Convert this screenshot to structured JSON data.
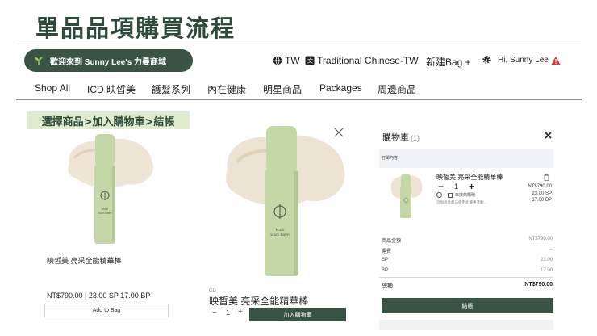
{
  "page": {
    "title": "單品品項購買流程"
  },
  "header": {
    "welcome_text": "歡迎來到 Sunny Lee's  力曼商城",
    "region": "TW",
    "language": "Traditional Chinese-TW",
    "new_bag": "新建Bag +",
    "greeting": "Hi, Sunny Lee"
  },
  "nav": {
    "items": [
      "Shop All",
      "ICD 映皙美",
      "護髮系列",
      "內在健康",
      "明星商品",
      "Packages",
      "周邊商品"
    ]
  },
  "steps": {
    "label": "選擇商品>加入購物車>結帳"
  },
  "product_card": {
    "name": "映皙美 亮采全能精華棒",
    "price": "NT$790.00 | 23.00 SP 17.00 BP",
    "add_button": "Add to Bag",
    "stick_text": "Multi\nStick Balm"
  },
  "product_modal": {
    "brand": "CD",
    "name": "映皙美 亮采全能精華棒",
    "qty": "1",
    "minus": "−",
    "plus": "+",
    "add_button": "加入購物車",
    "stick_text": "Multi\nStick Balm"
  },
  "cart": {
    "title": "購物車",
    "count": "(1)",
    "section_label": "訂單內容",
    "item": {
      "name": "映皙美 亮采全能精華棒",
      "qty": "1",
      "minus": "−",
      "plus": "+",
      "price": "NT$790.00",
      "sp": "23.00  SP",
      "bp": "17.00  BP",
      "gift_label": "串接商購贈",
      "note": "這個商品無法使用此優惠活動..."
    },
    "summary": [
      {
        "label": "商品金額",
        "value": "NT$790.00"
      },
      {
        "label": "運費",
        "value": "--"
      },
      {
        "label": "SP",
        "value": "23.00"
      },
      {
        "label": "BP",
        "value": "17.00"
      }
    ],
    "total_label": "總額",
    "total_value": "NT$790.00",
    "checkout_button": "結帳"
  },
  "colors": {
    "brand_green": "#3a5443",
    "banner_green": "#dfeccd",
    "title_green": "#2e4a3a",
    "alert_red": "#d03a3a"
  }
}
